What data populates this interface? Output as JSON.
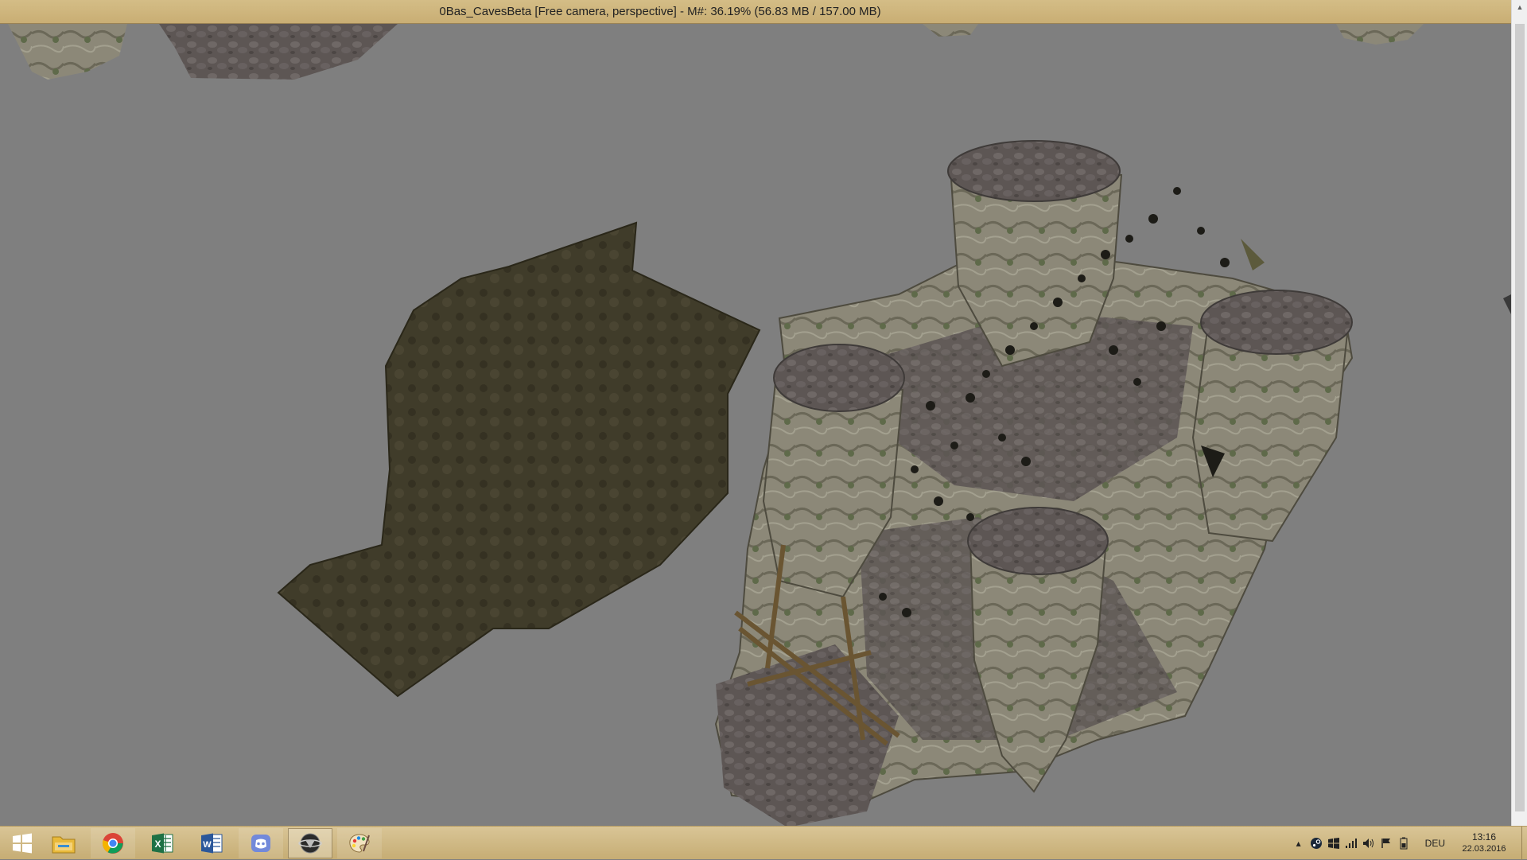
{
  "window": {
    "title": "0Bas_CavesBeta [Free camera, perspective] - M#: 36.19% (56.83 MB / 157.00 MB)"
  },
  "viewport": {
    "background": "#7f7f7f",
    "scene": "3d-cave-model"
  },
  "taskbar": {
    "buttons": [
      {
        "name": "start-button",
        "icon": "windows-logo-icon",
        "state": "normal"
      },
      {
        "name": "file-explorer-button",
        "icon": "folder-icon",
        "state": "normal"
      },
      {
        "name": "chrome-button",
        "icon": "chrome-icon",
        "state": "open"
      },
      {
        "name": "excel-button",
        "icon": "excel-icon",
        "state": "normal"
      },
      {
        "name": "word-button",
        "icon": "word-icon",
        "state": "normal"
      },
      {
        "name": "discord-button",
        "icon": "discord-icon",
        "state": "open"
      },
      {
        "name": "construction-set-button",
        "icon": "construction-set-icon",
        "state": "active"
      },
      {
        "name": "paint-button",
        "icon": "paint-palette-icon",
        "state": "open"
      }
    ],
    "tray": {
      "language": "DEU",
      "time": "13:16",
      "date": "22.03.2016"
    }
  },
  "colors": {
    "taskbar": "#d0b985",
    "titlebar": "#cfb57d",
    "rock": "#8a8676",
    "cobble": "#5c5552",
    "moss": "#3f3b28"
  }
}
